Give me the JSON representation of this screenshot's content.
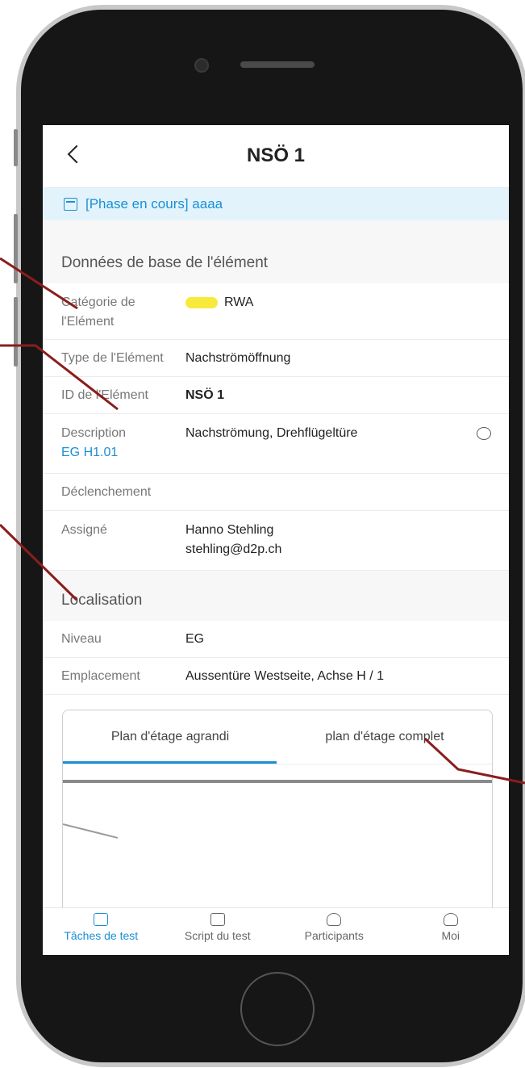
{
  "nav": {
    "title": "NSÖ 1"
  },
  "phase": {
    "text": "[Phase en cours] aaaa"
  },
  "section_base": {
    "title": "Données de base de l'élément"
  },
  "fields": {
    "category": {
      "label": "Catégorie de l'Elément",
      "value": "RWA",
      "pill_color": "#f7ea3c"
    },
    "type": {
      "label": "Type de l'Elément",
      "value": "Nachströmöffnung"
    },
    "id": {
      "label": "ID de l'Elément",
      "value": "NSÖ 1"
    },
    "description": {
      "label": "Description",
      "value": "Nachströmung, Drehflügeltüre",
      "link": "EG H1.01"
    },
    "trigger": {
      "label": "Déclenchement",
      "value": ""
    },
    "assigned": {
      "label": "Assigné",
      "name": "Hanno Stehling",
      "email": "stehling@d2p.ch"
    }
  },
  "section_loc": {
    "title": "Localisation"
  },
  "loc": {
    "level": {
      "label": "Niveau",
      "value": "EG"
    },
    "place": {
      "label": "Emplacement",
      "value": "Aussentüre Westseite, Achse H / 1"
    }
  },
  "map": {
    "tab1": "Plan d'étage agrandi",
    "tab2": "plan d'étage complet"
  },
  "tabbar": {
    "t1": "Tâches de test",
    "t2": "Script du test",
    "t3": "Participants",
    "t4": "Moi"
  },
  "colors": {
    "accent": "#1a8fd6",
    "annotation": "#8b1d1d"
  }
}
